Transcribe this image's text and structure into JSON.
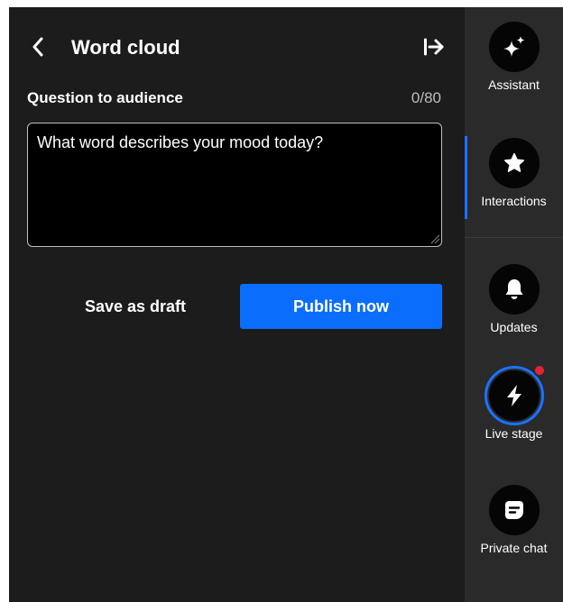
{
  "header": {
    "title": "Word cloud"
  },
  "question": {
    "label": "Question to audience",
    "count": "0/80",
    "value": "What word describes your mood today?"
  },
  "actions": {
    "draft_label": "Save as draft",
    "publish_label": "Publish now"
  },
  "rail": {
    "items": [
      {
        "label": "Assistant",
        "icon": "sparkle-icon"
      },
      {
        "label": "Interactions",
        "icon": "star-icon",
        "active": true
      },
      {
        "label": "Updates",
        "icon": "bell-icon"
      },
      {
        "label": "Live stage",
        "icon": "bolt-icon",
        "badge": true
      },
      {
        "label": "Private chat",
        "icon": "chat-icon"
      }
    ]
  },
  "colors": {
    "background": "#1c1c1c",
    "rail": "#2a2a2a",
    "accent": "#0a6dfb",
    "badge": "#e8213b"
  }
}
